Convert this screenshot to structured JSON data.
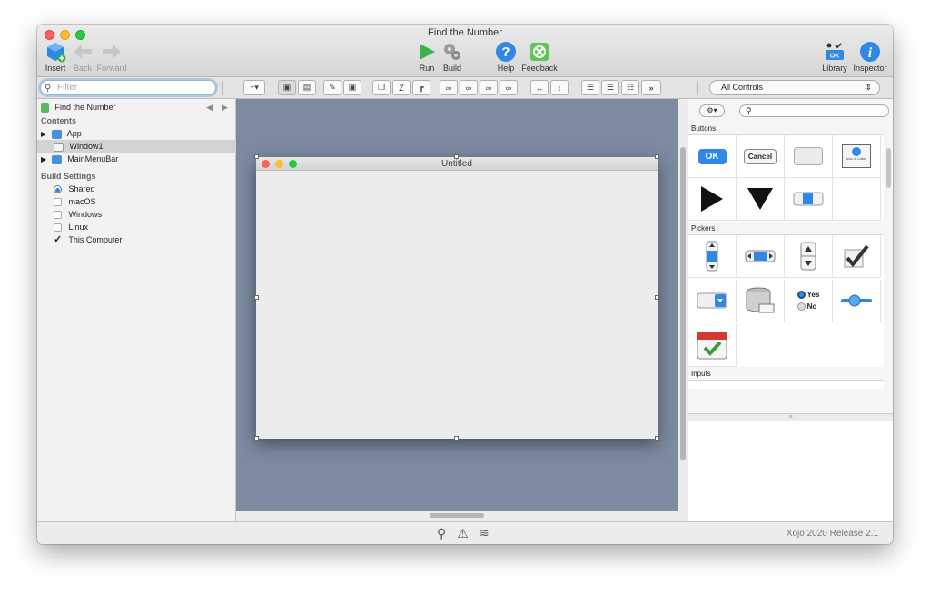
{
  "window": {
    "title": "Find the Number"
  },
  "toolbar": {
    "insert": "Insert",
    "back": "Back",
    "forward": "Forward",
    "run": "Run",
    "build": "Build",
    "help": "Help",
    "feedback": "Feedback",
    "library": "Library",
    "inspector": "Inspector"
  },
  "filter": {
    "placeholder": "Filter"
  },
  "controls_dropdown": {
    "selected": "All Controls"
  },
  "navigator": {
    "project": "Find the Number",
    "contents_header": "Contents",
    "items": [
      "App",
      "Window1",
      "MainMenuBar"
    ],
    "build_settings_header": "Build Settings",
    "build_targets": [
      {
        "label": "Shared",
        "checked": "radio"
      },
      {
        "label": "macOS",
        "checked": "no"
      },
      {
        "label": "Windows",
        "checked": "no"
      },
      {
        "label": "Linux",
        "checked": "no"
      },
      {
        "label": "This Computer",
        "checked": "yes"
      }
    ]
  },
  "designer": {
    "window_title": "Untitled"
  },
  "library": {
    "categories": [
      "Buttons",
      "Pickers",
      "Inputs"
    ],
    "ok_label": "OK",
    "cancel_label": "Cancel",
    "icon_label": "Icon & Label",
    "radio_yes": "Yes",
    "radio_no": "No"
  },
  "status": {
    "version": "Xojo 2020 Release 2.1"
  },
  "colors": {
    "canvas": "#7c8ba0",
    "accent": "#2f87e6",
    "run_green": "#3cb34a"
  }
}
